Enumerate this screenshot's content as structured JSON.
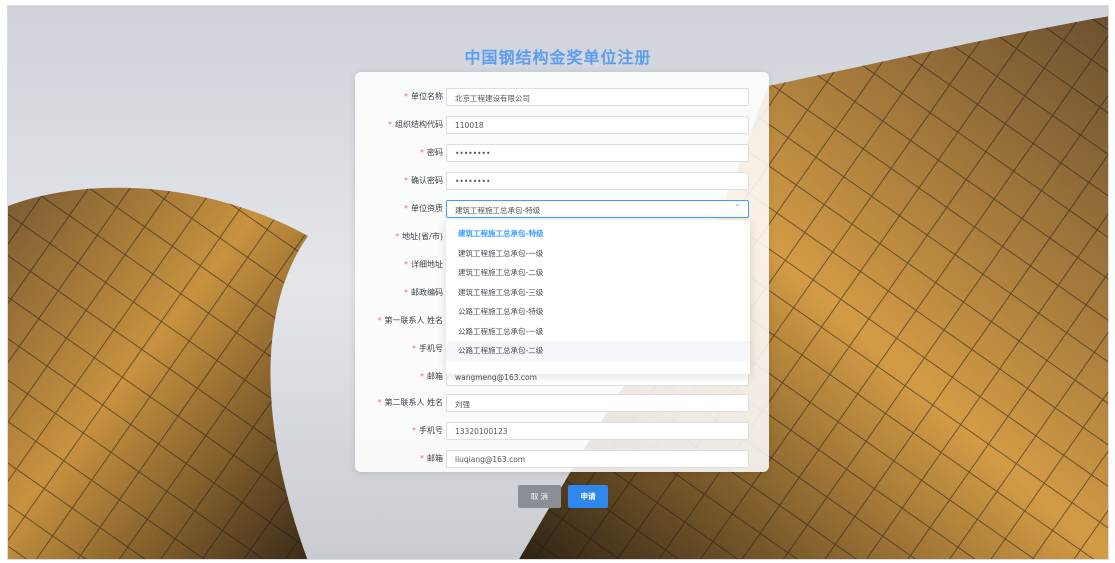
{
  "page": {
    "title": "中国钢结构金奖单位注册"
  },
  "form": {
    "fields": [
      {
        "label": "单位名称",
        "value": "北京工程建设有限公司"
      },
      {
        "label": "组织结构代码",
        "value": "110018"
      },
      {
        "label": "密码",
        "value": "••••••••"
      },
      {
        "label": "确认密码",
        "value": "••••••••"
      },
      {
        "label": "单位资质",
        "value": "建筑工程施工总承包-特级"
      },
      {
        "label": "地址(省/市)",
        "value": ""
      },
      {
        "label": "详细地址",
        "value": ""
      },
      {
        "label": "邮政编码",
        "value": ""
      },
      {
        "label": "第一联系人 姓名",
        "value": ""
      },
      {
        "label": "手机号",
        "value": ""
      },
      {
        "label": "邮箱",
        "value": "wangmeng@163.com"
      },
      {
        "label": "第二联系人 姓名",
        "value": "刘强"
      },
      {
        "label": "手机号",
        "value": "13320100123"
      },
      {
        "label": "邮箱",
        "value": "liuqiang@163.com"
      }
    ]
  },
  "dropdown": {
    "options": [
      "建筑工程施工总承包-特级",
      "建筑工程施工总承包-一级",
      "建筑工程施工总承包-二级",
      "建筑工程施工总承包-三级",
      "公路工程施工总承包-特级",
      "公路工程施工总承包-一级",
      "公路工程施工总承包-二级"
    ]
  },
  "buttons": {
    "cancel": "取 消",
    "submit": "申请"
  },
  "colors": {
    "accent": "#409eff",
    "title": "#5b9ef0",
    "required": "#f56c6c"
  }
}
